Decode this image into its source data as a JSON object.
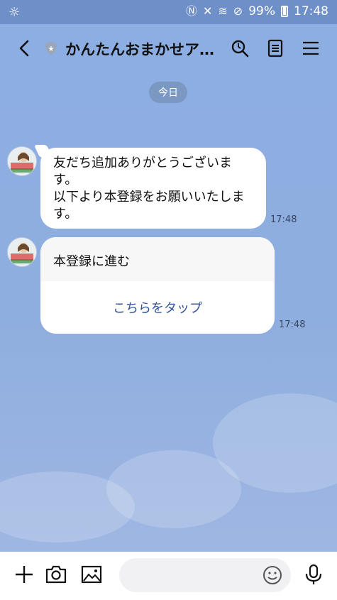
{
  "status_bar": {
    "battery_percent": "99%",
    "time": "17:48"
  },
  "header": {
    "title": "かんたんおまかせア…"
  },
  "date_separator": "今日",
  "messages": [
    {
      "type": "text",
      "text_lines": [
        "友だち追加ありがとうございま",
        "す。",
        "以下より本登録をお願いいたしま",
        "す。"
      ],
      "time": "17:48"
    },
    {
      "type": "card",
      "title": "本登録に進む",
      "action_label": "こちらをタップ",
      "time": "17:48"
    }
  ],
  "icons": {
    "back": "chevron-left-icon",
    "official_badge": "shield-star-icon",
    "search": "search-icon",
    "notes": "notes-icon",
    "menu": "hamburger-menu-icon",
    "add": "plus-icon",
    "camera": "camera-icon",
    "photo": "image-icon",
    "emoji": "emoji-smile-icon",
    "mic": "microphone-icon"
  },
  "colors": {
    "chat_background": "#8eaedf",
    "status_bar": "#6f8fc9",
    "link_text": "#32579a"
  }
}
